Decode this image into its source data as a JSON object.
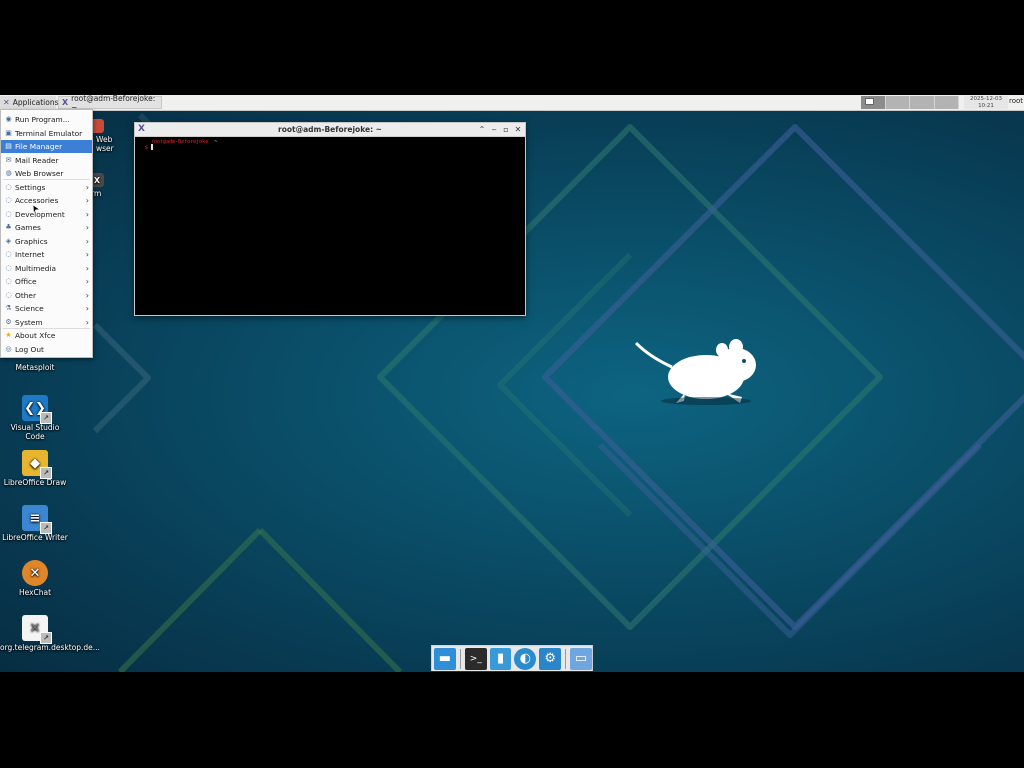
{
  "top_panel": {
    "applications_label": "Applications",
    "task_label": "root@adm-Beforejoke: ~",
    "clock": {
      "date": "2025-12-03",
      "time": "10:21"
    },
    "user": "root"
  },
  "app_menu": {
    "items": [
      {
        "label": "Run Program...",
        "icon": "run-icon",
        "submenu": false,
        "highlight": false
      },
      {
        "label": "Terminal Emulator",
        "icon": "terminal-icon",
        "submenu": false,
        "highlight": false
      },
      {
        "label": "File Manager",
        "icon": "file-manager-icon",
        "submenu": false,
        "highlight": true
      },
      {
        "label": "Mail Reader",
        "icon": "mail-icon",
        "submenu": false,
        "highlight": false
      },
      {
        "label": "Web Browser",
        "icon": "globe-icon",
        "submenu": false,
        "highlight": false
      },
      {
        "label": "Settings",
        "icon": "settings-icon",
        "submenu": true,
        "highlight": false
      },
      {
        "label": "Accessories",
        "icon": "accessories-icon",
        "submenu": true,
        "highlight": false
      },
      {
        "label": "Development",
        "icon": "development-icon",
        "submenu": true,
        "highlight": false
      },
      {
        "label": "Games",
        "icon": "games-icon",
        "submenu": true,
        "highlight": false
      },
      {
        "label": "Graphics",
        "icon": "graphics-icon",
        "submenu": true,
        "highlight": false
      },
      {
        "label": "Internet",
        "icon": "internet-icon",
        "submenu": true,
        "highlight": false
      },
      {
        "label": "Multimedia",
        "icon": "multimedia-icon",
        "submenu": true,
        "highlight": false
      },
      {
        "label": "Office",
        "icon": "office-icon",
        "submenu": true,
        "highlight": false
      },
      {
        "label": "Other",
        "icon": "other-icon",
        "submenu": true,
        "highlight": false
      },
      {
        "label": "Science",
        "icon": "science-icon",
        "submenu": true,
        "highlight": false
      },
      {
        "label": "System",
        "icon": "system-icon",
        "submenu": true,
        "highlight": false
      },
      {
        "label": "About Xfce",
        "icon": "star-icon",
        "submenu": false,
        "highlight": false
      },
      {
        "label": "Log Out",
        "icon": "logout-icon",
        "submenu": false,
        "highlight": false
      }
    ]
  },
  "terminal": {
    "title": "root@adm-Beforejoke: ~",
    "prompt_user": "root",
    "prompt_host": "adm-Beforejoke",
    "prompt_dir": "~",
    "prompt_symbol": "$"
  },
  "desktop_icons": [
    {
      "label": "Web Browser",
      "partial_label": "Web\nwser",
      "icon": "web-browser-icon"
    },
    {
      "label": "Terminal",
      "partial_label": "rm",
      "icon": "terminal-shortcut-icon"
    },
    {
      "label": "Metasploit",
      "icon": "metasploit-icon"
    },
    {
      "label": "Visual Studio Code",
      "icon": "vscode-icon"
    },
    {
      "label": "LibreOffice Draw",
      "icon": "libreoffice-draw-icon"
    },
    {
      "label": "LibreOffice Writer",
      "icon": "libreoffice-writer-icon"
    },
    {
      "label": "HexChat",
      "icon": "hexchat-icon"
    },
    {
      "label": "org.telegram.desktop.de...",
      "icon": "telegram-icon"
    }
  ],
  "dock": {
    "items": [
      "show-desktop-icon",
      "terminal-icon",
      "file-manager-icon",
      "web-browser-icon",
      "settings-icon",
      "folder-icon"
    ]
  },
  "colors": {
    "menu_highlight": "#3b80d6",
    "prompt_red": "#e02828",
    "desktop_bg": "#0a4e68"
  }
}
